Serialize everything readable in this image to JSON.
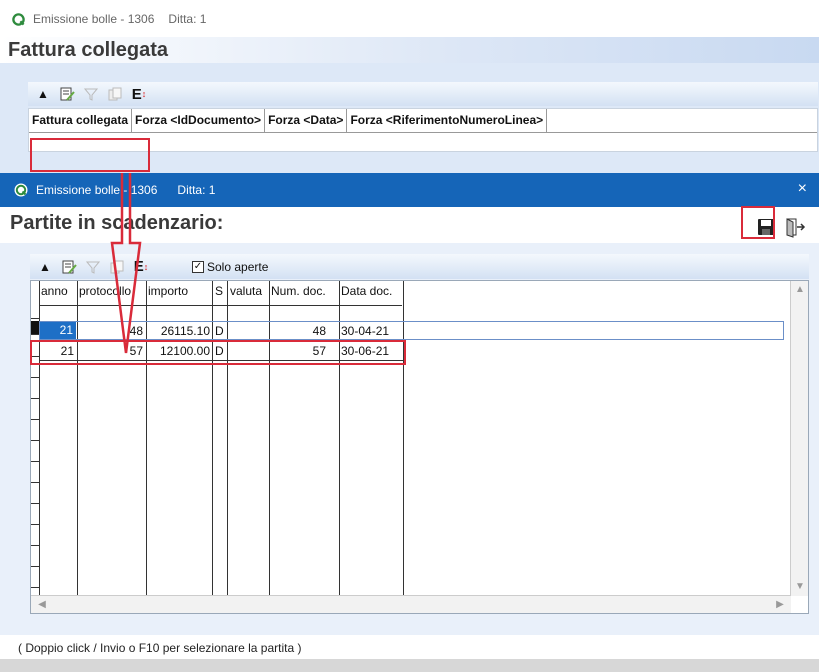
{
  "background_window": {
    "title": "Emissione bolle - 1306",
    "ditta": "Ditta: 1",
    "heading": "Fattura collegata",
    "columns": [
      "Fattura collegata",
      "Forza <IdDocumento>",
      "Forza <Data>",
      "Forza <RiferimentoNumeroLinea>"
    ]
  },
  "dialog": {
    "title": "Emissione bolle - 1306",
    "ditta": "Ditta: 1",
    "close": "×",
    "heading": "Partite in scadenzario:",
    "filter_label": "Solo aperte",
    "filter_checked": true,
    "columns": [
      "anno",
      "protocollo",
      "importo",
      "S",
      "valuta",
      "Num. doc.",
      "Data doc."
    ],
    "rows": [
      {
        "anno": "21",
        "protocollo": "48",
        "importo": "26115.10",
        "s": "D",
        "valuta": "",
        "num_doc": "48",
        "data_doc": "30-04-21",
        "selected": true
      },
      {
        "anno": "21",
        "protocollo": "57",
        "importo": "12100.00",
        "s": "D",
        "valuta": "",
        "num_doc": "57",
        "data_doc": "30-06-21",
        "selected": false
      }
    ],
    "status": "( Doppio click / Invio o F10 per selezionare la partita )"
  },
  "icons": {
    "app": "app-logo-icon",
    "save": "floppy-save-icon",
    "exit": "exit-door-icon",
    "toolbar": [
      "arrow-up-icon",
      "edit-filter-icon",
      "funnel-icon",
      "copy-icon",
      "export-e-icon"
    ]
  },
  "annotation_color": "#d92b3a",
  "accent_titlebar": "#1565b8"
}
